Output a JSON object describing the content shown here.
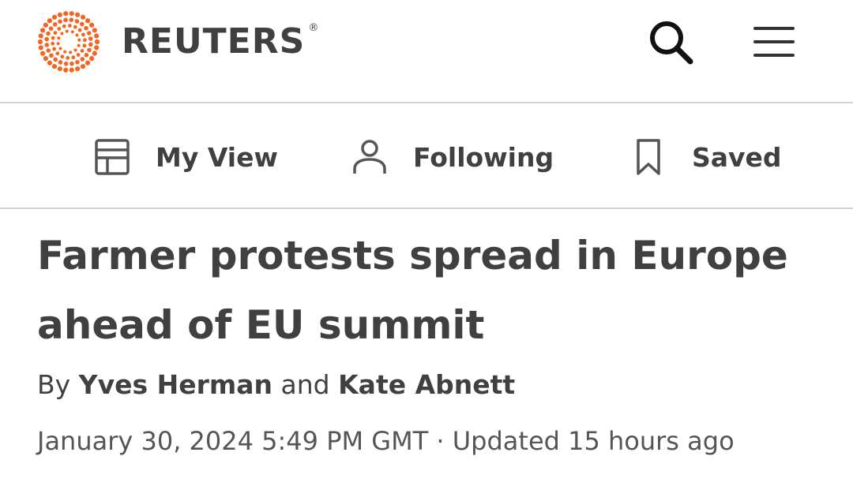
{
  "header": {
    "brand": "REUTERS",
    "registered_mark": "®",
    "logo_icon": "reuters-dot-logo-icon",
    "search_icon": "search-icon",
    "menu_icon": "hamburger-menu-icon",
    "brand_color": "#f26522"
  },
  "nav": {
    "items": [
      {
        "label": "My View",
        "icon": "layout-icon"
      },
      {
        "label": "Following",
        "icon": "person-icon"
      },
      {
        "label": "Saved",
        "icon": "bookmark-icon"
      }
    ]
  },
  "article": {
    "headline_line1": "Farmer protests spread in Europe",
    "headline_line2": "ahead of EU summit",
    "byline_prefix": "By",
    "author1": "Yves Herman",
    "byline_joiner": "and",
    "author2": "Kate Abnett",
    "published": "January 30, 2024 5:49 PM GMT",
    "separator": "·",
    "updated": "Updated 15 hours ago"
  }
}
